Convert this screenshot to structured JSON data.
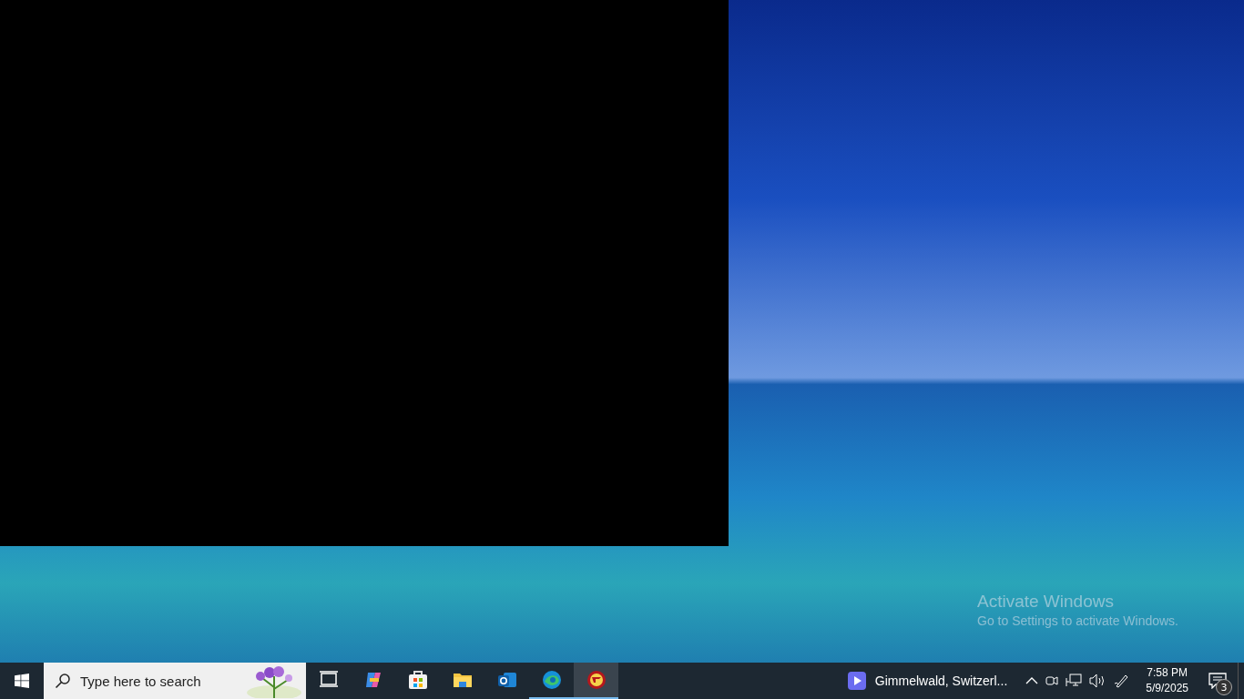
{
  "desktop": {
    "watermark_title": "Activate Windows",
    "watermark_text": "Go to Settings to activate Windows."
  },
  "taskbar": {
    "search": {
      "placeholder": "Type here to search"
    },
    "apps": [
      {
        "kind": "taskview",
        "running": false,
        "active": false
      },
      {
        "kind": "copilot",
        "running": false,
        "active": false
      },
      {
        "kind": "store",
        "running": false,
        "active": false
      },
      {
        "kind": "explorer",
        "running": false,
        "active": false
      },
      {
        "kind": "outlook",
        "running": false,
        "active": false
      },
      {
        "kind": "edge",
        "running": true,
        "active": false
      },
      {
        "kind": "game",
        "running": true,
        "active": true
      }
    ],
    "media": {
      "title": "Gimmelwald, Switzerl..."
    },
    "clock": {
      "time": "7:58 PM",
      "date": "5/9/2025"
    },
    "notifications": {
      "count": "3"
    }
  }
}
